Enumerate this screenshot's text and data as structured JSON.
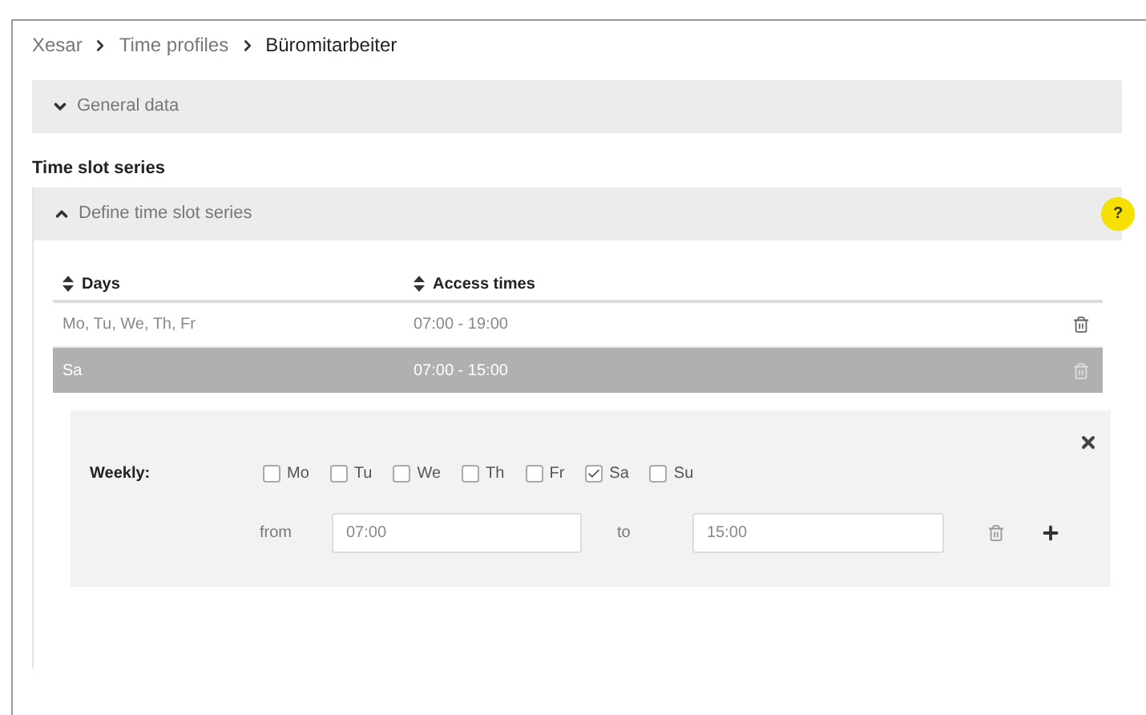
{
  "breadcrumb": [
    "Xesar",
    "Time profiles",
    "Büromitarbeiter"
  ],
  "general_section": {
    "title": "General data",
    "expanded": false
  },
  "series_heading": "Time slot series",
  "define_section": {
    "title": "Define time slot series",
    "expanded": true,
    "help": "?"
  },
  "table": {
    "columns": [
      "Days",
      "Access times"
    ],
    "rows": [
      {
        "days": "Mo, Tu, We, Th, Fr",
        "times": "07:00 - 19:00",
        "selected": false
      },
      {
        "days": "Sa",
        "times": "07:00 - 15:00",
        "selected": true
      }
    ]
  },
  "editor": {
    "label": "Weekly:",
    "days": [
      {
        "label": "Mo",
        "checked": false
      },
      {
        "label": "Tu",
        "checked": false
      },
      {
        "label": "We",
        "checked": false
      },
      {
        "label": "Th",
        "checked": false
      },
      {
        "label": "Fr",
        "checked": false
      },
      {
        "label": "Sa",
        "checked": true
      },
      {
        "label": "Su",
        "checked": false
      }
    ],
    "from_label": "from",
    "from_value": "07:00",
    "to_label": "to",
    "to_value": "15:00"
  }
}
